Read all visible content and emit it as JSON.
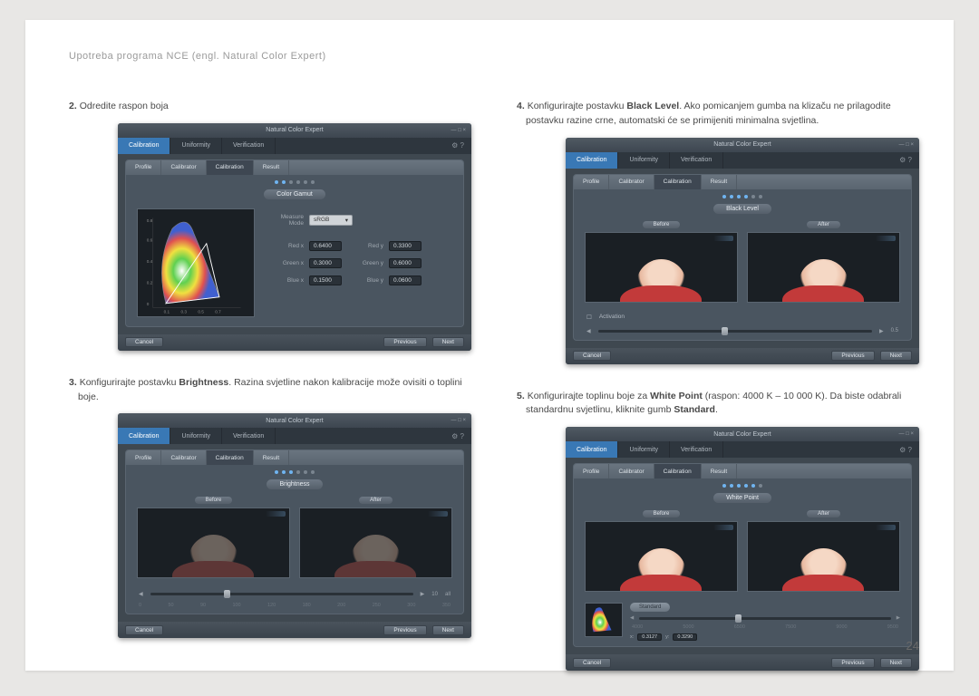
{
  "header": "Upotreba programa NCE (engl. Natural Color Expert)",
  "page_number": "24",
  "app": {
    "title": "Natural Color Expert",
    "top_tabs": [
      "Calibration",
      "Uniformity",
      "Verification"
    ],
    "step_tabs": [
      "Profile",
      "Calibrator",
      "Calibration",
      "Result"
    ],
    "buttons": {
      "cancel": "Cancel",
      "previous": "Previous",
      "next": "Next"
    },
    "preview": {
      "before": "Before",
      "after": "After"
    }
  },
  "steps": {
    "s2": {
      "num": "2.",
      "text": "Odredite raspon boja",
      "chip": "Color Gamut",
      "measure_mode_label": "Measure Mode",
      "measure_mode_value": "sRGB",
      "values": {
        "red_x_label": "Red x",
        "red_x": "0.6400",
        "red_y_label": "Red y",
        "red_y": "0.3300",
        "green_x_label": "Green x",
        "green_x": "0.3000",
        "green_y_label": "Green y",
        "green_y": "0.6000",
        "blue_x_label": "Blue x",
        "blue_x": "0.1500",
        "blue_y_label": "Blue y",
        "blue_y": "0.0600"
      }
    },
    "s3": {
      "num": "3.",
      "text_a": "Konfigurirajte postavku ",
      "bold": "Brightness",
      "text_b": ". Razina svjetline nakon kalibracije može ovisiti o toplini boje.",
      "chip": "Brightness",
      "ticks": [
        "0",
        "50",
        "90",
        "100",
        "120",
        "180",
        "200",
        "250",
        "300",
        "350"
      ],
      "unit_a": "10",
      "unit_b": "all"
    },
    "s4": {
      "num": "4.",
      "text_a": "Konfigurirajte postavku ",
      "bold": "Black Level",
      "text_b": ". Ako pomicanjem gumba na klizaču ne prilagodite postavku razine crne, automatski će se primijeniti minimalna svjetlina.",
      "chip": "Black Level",
      "checkbox": "Activation",
      "unit": "0.5"
    },
    "s5": {
      "num": "5.",
      "text_a": "Konfigurirajte toplinu boje za ",
      "bold": "White Point",
      "text_b": " (raspon: 4000 K – 10 000 K). Da biste odabrali standardnu svjetlinu, kliknite gumb ",
      "bold2": "Standard",
      "text_c": ".",
      "chip": "White Point",
      "standard": "Standard",
      "ticks": [
        "4000",
        "5000",
        "6500",
        "7500",
        "9000",
        "9500"
      ],
      "xy": {
        "x_label": "x:",
        "x": "0.3127",
        "y_label": "y:",
        "y": "0.3290"
      }
    }
  }
}
